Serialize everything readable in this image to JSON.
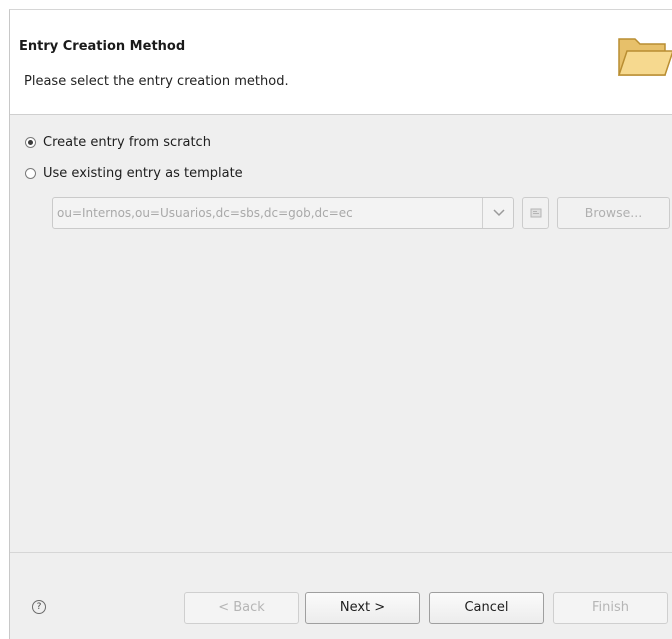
{
  "header": {
    "title": "Entry Creation Method",
    "description": "Please select the entry creation method.",
    "icon": "folder-icon"
  },
  "options": {
    "from_scratch": {
      "label": "Create entry from scratch",
      "selected": true
    },
    "use_template": {
      "label": "Use existing entry as template",
      "selected": false
    }
  },
  "template": {
    "value": "ou=Internos,ou=Usuarios,dc=sbs,dc=gob,dc=ec",
    "browse_label": "Browse..."
  },
  "footer": {
    "help_icon": "help-icon",
    "back_label": "< Back",
    "next_label": "Next >",
    "cancel_label": "Cancel",
    "finish_label": "Finish"
  },
  "colors": {
    "background": "#efefef",
    "header_background": "#ffffff",
    "disabled_text": "#b0b0b0",
    "folder_fill": "#f3d48a"
  }
}
